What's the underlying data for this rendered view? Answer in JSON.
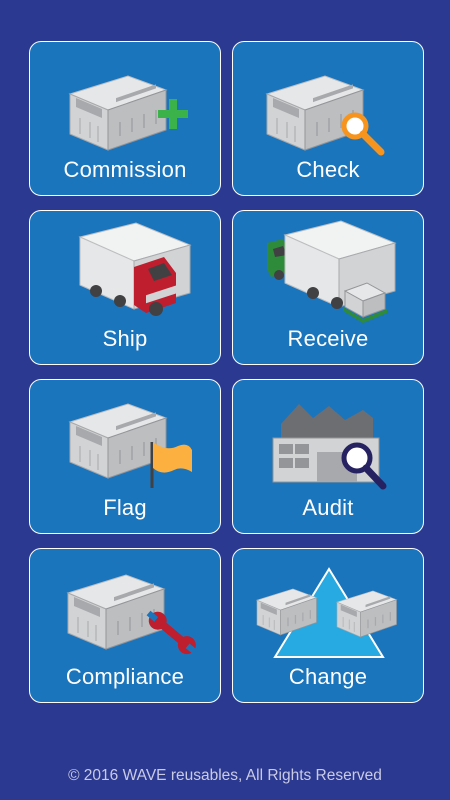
{
  "tiles": [
    {
      "label": "Commission",
      "icon": "crate-plus-icon"
    },
    {
      "label": "Check",
      "icon": "crate-magnifier-icon"
    },
    {
      "label": "Ship",
      "icon": "red-truck-icon"
    },
    {
      "label": "Receive",
      "icon": "green-truck-pallet-icon"
    },
    {
      "label": "Flag",
      "icon": "crate-flag-icon"
    },
    {
      "label": "Audit",
      "icon": "warehouse-magnifier-icon"
    },
    {
      "label": "Compliance",
      "icon": "crate-wrench-icon"
    },
    {
      "label": "Change",
      "icon": "crates-triangle-icon"
    }
  ],
  "footer": {
    "copyright": "© 2016 WAVE reusables, All Rights Reserved"
  },
  "colors": {
    "background": "#2b3990",
    "tile": "#1b75bc",
    "plus": "#3bb34a",
    "magnifier": "#f7941d",
    "truck_red": "#be1e2d",
    "truck_green": "#2e8b3a",
    "flag": "#fbb040",
    "wrench": "#be1e2d",
    "triangle": "#27aae1"
  }
}
